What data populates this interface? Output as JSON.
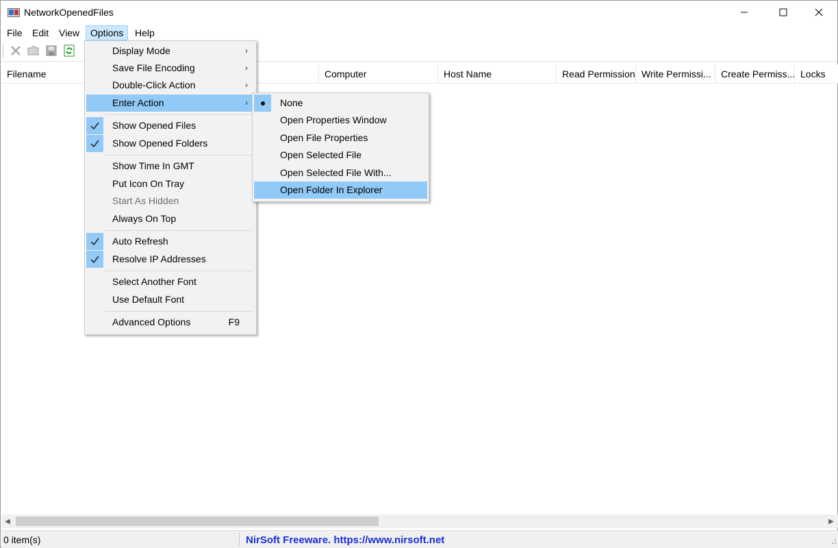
{
  "window": {
    "title": "NetworkOpenedFiles"
  },
  "menubar": [
    "File",
    "Edit",
    "View",
    "Options",
    "Help"
  ],
  "toolbar": {
    "icons": [
      "delete-icon",
      "open-folder-icon",
      "save-icon",
      "refresh-icon"
    ]
  },
  "columns": [
    "Filename",
    "Computer",
    "Host Name",
    "Read Permission",
    "Write Permissi...",
    "Create Permiss...",
    "Locks"
  ],
  "options_menu": {
    "items": {
      "display_mode": "Display Mode",
      "save_file_encoding": "Save File Encoding",
      "double_click_action": "Double-Click Action",
      "enter_action": "Enter Action",
      "show_opened_files": "Show Opened Files",
      "show_opened_folders": "Show Opened Folders",
      "show_time_in_gmt": "Show Time In GMT",
      "put_icon_on_tray": "Put Icon On Tray",
      "start_as_hidden": "Start As Hidden",
      "always_on_top": "Always On Top",
      "auto_refresh": "Auto Refresh",
      "resolve_ip_addresses": "Resolve IP Addresses",
      "select_another_font": "Select Another Font",
      "use_default_font": "Use Default Font",
      "advanced_options": "Advanced Options",
      "advanced_options_shortcut": "F9"
    }
  },
  "enter_action_submenu": {
    "items": [
      "None",
      "Open Properties Window",
      "Open File Properties",
      "Open Selected File",
      "Open Selected File With...",
      "Open Folder In Explorer"
    ],
    "selected": "None",
    "highlighted": "Open Folder In Explorer"
  },
  "statusbar": {
    "items_count": "0 item(s)",
    "credit": "NirSoft Freeware. https://www.nirsoft.net"
  },
  "colors": {
    "menu_highlight": "#91c9f7",
    "menubar_active": "#cce8ff",
    "link": "#1c2fd6"
  }
}
